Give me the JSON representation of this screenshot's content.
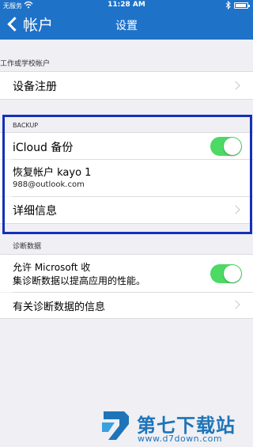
{
  "status_bar": {
    "carrier": "无服务",
    "time": "11:28 AM"
  },
  "nav": {
    "back_label": "帐户",
    "title": "设置"
  },
  "sections": {
    "work_school": {
      "header": "工作或学校帐户",
      "device_registration": "设备注册"
    },
    "backup": {
      "header": "BACKUP",
      "icloud_backup": "iCloud 备份",
      "icloud_backup_on": true,
      "restore_account": "恢复帐户 kayo 1",
      "restore_email": "988@outlook.com",
      "details": "详细信息"
    },
    "diagnostics": {
      "header": "诊断数据",
      "allow_collect_line1": "允许 Microsoft 收",
      "allow_collect_line2": "集诊断数据以提高应用的性能。",
      "allow_collect_on": true,
      "about_data": "有关诊断数据的信息"
    }
  },
  "watermark": {
    "title": "第七下载站",
    "url": "www.d7down.com"
  },
  "colors": {
    "nav_blue": "#1e72c8",
    "toggle_green": "#4cd964",
    "highlight_border": "#1430b8"
  }
}
